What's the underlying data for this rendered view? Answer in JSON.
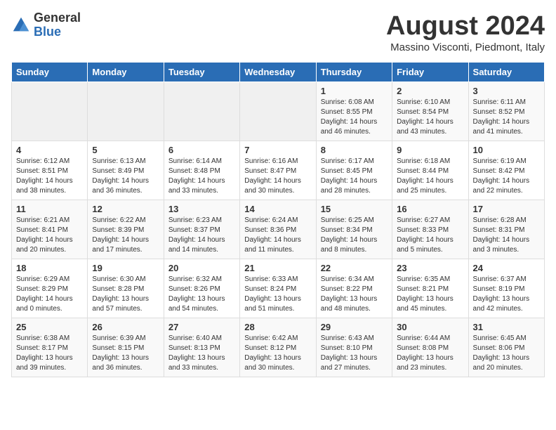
{
  "logo": {
    "general": "General",
    "blue": "Blue"
  },
  "title": {
    "month_year": "August 2024",
    "location": "Massino Visconti, Piedmont, Italy"
  },
  "headers": [
    "Sunday",
    "Monday",
    "Tuesday",
    "Wednesday",
    "Thursday",
    "Friday",
    "Saturday"
  ],
  "weeks": [
    [
      {
        "day": "",
        "content": ""
      },
      {
        "day": "",
        "content": ""
      },
      {
        "day": "",
        "content": ""
      },
      {
        "day": "",
        "content": ""
      },
      {
        "day": "1",
        "content": "Sunrise: 6:08 AM\nSunset: 8:55 PM\nDaylight: 14 hours\nand 46 minutes."
      },
      {
        "day": "2",
        "content": "Sunrise: 6:10 AM\nSunset: 8:54 PM\nDaylight: 14 hours\nand 43 minutes."
      },
      {
        "day": "3",
        "content": "Sunrise: 6:11 AM\nSunset: 8:52 PM\nDaylight: 14 hours\nand 41 minutes."
      }
    ],
    [
      {
        "day": "4",
        "content": "Sunrise: 6:12 AM\nSunset: 8:51 PM\nDaylight: 14 hours\nand 38 minutes."
      },
      {
        "day": "5",
        "content": "Sunrise: 6:13 AM\nSunset: 8:49 PM\nDaylight: 14 hours\nand 36 minutes."
      },
      {
        "day": "6",
        "content": "Sunrise: 6:14 AM\nSunset: 8:48 PM\nDaylight: 14 hours\nand 33 minutes."
      },
      {
        "day": "7",
        "content": "Sunrise: 6:16 AM\nSunset: 8:47 PM\nDaylight: 14 hours\nand 30 minutes."
      },
      {
        "day": "8",
        "content": "Sunrise: 6:17 AM\nSunset: 8:45 PM\nDaylight: 14 hours\nand 28 minutes."
      },
      {
        "day": "9",
        "content": "Sunrise: 6:18 AM\nSunset: 8:44 PM\nDaylight: 14 hours\nand 25 minutes."
      },
      {
        "day": "10",
        "content": "Sunrise: 6:19 AM\nSunset: 8:42 PM\nDaylight: 14 hours\nand 22 minutes."
      }
    ],
    [
      {
        "day": "11",
        "content": "Sunrise: 6:21 AM\nSunset: 8:41 PM\nDaylight: 14 hours\nand 20 minutes."
      },
      {
        "day": "12",
        "content": "Sunrise: 6:22 AM\nSunset: 8:39 PM\nDaylight: 14 hours\nand 17 minutes."
      },
      {
        "day": "13",
        "content": "Sunrise: 6:23 AM\nSunset: 8:37 PM\nDaylight: 14 hours\nand 14 minutes."
      },
      {
        "day": "14",
        "content": "Sunrise: 6:24 AM\nSunset: 8:36 PM\nDaylight: 14 hours\nand 11 minutes."
      },
      {
        "day": "15",
        "content": "Sunrise: 6:25 AM\nSunset: 8:34 PM\nDaylight: 14 hours\nand 8 minutes."
      },
      {
        "day": "16",
        "content": "Sunrise: 6:27 AM\nSunset: 8:33 PM\nDaylight: 14 hours\nand 5 minutes."
      },
      {
        "day": "17",
        "content": "Sunrise: 6:28 AM\nSunset: 8:31 PM\nDaylight: 14 hours\nand 3 minutes."
      }
    ],
    [
      {
        "day": "18",
        "content": "Sunrise: 6:29 AM\nSunset: 8:29 PM\nDaylight: 14 hours\nand 0 minutes."
      },
      {
        "day": "19",
        "content": "Sunrise: 6:30 AM\nSunset: 8:28 PM\nDaylight: 13 hours\nand 57 minutes."
      },
      {
        "day": "20",
        "content": "Sunrise: 6:32 AM\nSunset: 8:26 PM\nDaylight: 13 hours\nand 54 minutes."
      },
      {
        "day": "21",
        "content": "Sunrise: 6:33 AM\nSunset: 8:24 PM\nDaylight: 13 hours\nand 51 minutes."
      },
      {
        "day": "22",
        "content": "Sunrise: 6:34 AM\nSunset: 8:22 PM\nDaylight: 13 hours\nand 48 minutes."
      },
      {
        "day": "23",
        "content": "Sunrise: 6:35 AM\nSunset: 8:21 PM\nDaylight: 13 hours\nand 45 minutes."
      },
      {
        "day": "24",
        "content": "Sunrise: 6:37 AM\nSunset: 8:19 PM\nDaylight: 13 hours\nand 42 minutes."
      }
    ],
    [
      {
        "day": "25",
        "content": "Sunrise: 6:38 AM\nSunset: 8:17 PM\nDaylight: 13 hours\nand 39 minutes."
      },
      {
        "day": "26",
        "content": "Sunrise: 6:39 AM\nSunset: 8:15 PM\nDaylight: 13 hours\nand 36 minutes."
      },
      {
        "day": "27",
        "content": "Sunrise: 6:40 AM\nSunset: 8:13 PM\nDaylight: 13 hours\nand 33 minutes."
      },
      {
        "day": "28",
        "content": "Sunrise: 6:42 AM\nSunset: 8:12 PM\nDaylight: 13 hours\nand 30 minutes."
      },
      {
        "day": "29",
        "content": "Sunrise: 6:43 AM\nSunset: 8:10 PM\nDaylight: 13 hours\nand 27 minutes."
      },
      {
        "day": "30",
        "content": "Sunrise: 6:44 AM\nSunset: 8:08 PM\nDaylight: 13 hours\nand 23 minutes."
      },
      {
        "day": "31",
        "content": "Sunrise: 6:45 AM\nSunset: 8:06 PM\nDaylight: 13 hours\nand 20 minutes."
      }
    ]
  ]
}
